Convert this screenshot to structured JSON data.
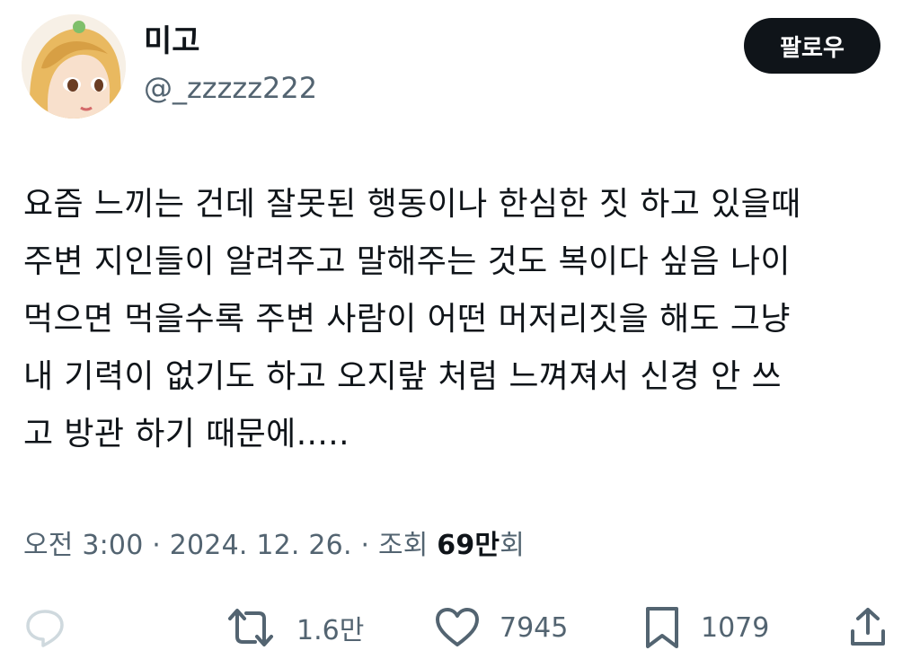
{
  "user": {
    "display_name": "미고",
    "handle": "@_zzzzz222"
  },
  "follow_button": {
    "label": "팔로우"
  },
  "tweet": {
    "lines": [
      "요즘 느끼는 건데 잘못된 행동이나 한심한 짓 하고 있을때",
      "주변 지인들이 알려주고 말해주는 것도 복이다 싶음 나이",
      "먹으면 먹을수록 주변 사람이 어떤 머저리짓을 해도 그냥",
      "내 기력이 없기도 하고 오지랖 처럼 느껴져서 신경 안 쓰",
      "고 방관 하기 때문에....."
    ]
  },
  "meta": {
    "time": "오전 3:00",
    "sep1": " · ",
    "date": "2024. 12. 26.",
    "sep2": " · ",
    "views_label": "조회 ",
    "views_count": "69만",
    "views_suffix": "회"
  },
  "actions": {
    "reply": {
      "icon": "reply-icon",
      "count": ""
    },
    "repost": {
      "icon": "repost-icon",
      "count": "1.6만"
    },
    "like": {
      "icon": "heart-icon",
      "count": "7945"
    },
    "bookmark": {
      "icon": "bookmark-icon",
      "count": "1079"
    },
    "share": {
      "icon": "share-icon",
      "count": ""
    }
  },
  "colors": {
    "text": "#0f1419",
    "secondary": "#536471",
    "reply_icon": "#cfd9de",
    "follow_bg": "#0f1419"
  }
}
